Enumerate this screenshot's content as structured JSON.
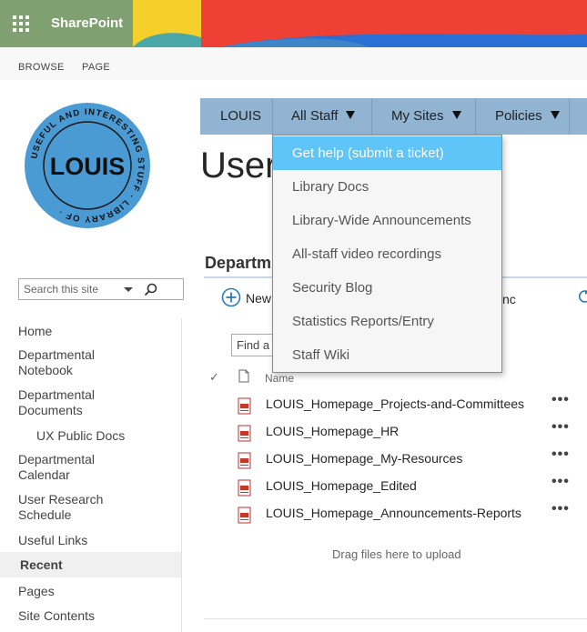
{
  "suite_bar": {
    "brand": "SharePoint",
    "colors": {
      "bar": "#7fa071",
      "banner_yellow": "#f5cf2a",
      "banner_teal": "#4aa9a8",
      "banner_red": "#ee4035",
      "banner_blue": "#2a6fd6"
    }
  },
  "ribbon": {
    "tabs": [
      "BROWSE",
      "PAGE"
    ]
  },
  "logo": {
    "text": "LOUIS",
    "ring_text": "USEFUL AND INTERESTING STUFF · LIBRARY OF ·",
    "color": "#4a9ad4"
  },
  "search": {
    "placeholder": "Search this site"
  },
  "left_nav": {
    "items": [
      {
        "label": "Home"
      },
      {
        "label": "Departmental Notebook"
      },
      {
        "label": "Departmental Documents"
      },
      {
        "label": "UX Public Docs"
      },
      {
        "label": "Departmental Calendar"
      },
      {
        "label": "User Research Schedule"
      },
      {
        "label": "Useful Links"
      },
      {
        "label": "Recent"
      },
      {
        "label": "Pages"
      },
      {
        "label": "Site Contents"
      }
    ]
  },
  "top_nav": {
    "items": [
      {
        "label": "LOUIS"
      },
      {
        "label": "All Staff"
      },
      {
        "label": "My Sites"
      },
      {
        "label": "Policies"
      }
    ],
    "color": "#91b4d3"
  },
  "page": {
    "title": "User"
  },
  "webpart": {
    "title": "Departm",
    "new_label": "New",
    "sync_fragment": "nc",
    "find_placeholder": "Find a",
    "column_name": "Name",
    "files": [
      {
        "name": "LOUIS_Homepage_Projects-and-Committees"
      },
      {
        "name": "LOUIS_Homepage_HR"
      },
      {
        "name": "LOUIS_Homepage_My-Resources"
      },
      {
        "name": "LOUIS_Homepage_Edited"
      },
      {
        "name": "LOUIS_Homepage_Announcements-Reports"
      }
    ],
    "more_label": "•••",
    "drag_hint": "Drag files here to upload"
  },
  "dropdown": {
    "items": [
      {
        "label": "Get help (submit a ticket)",
        "active": true
      },
      {
        "label": "Library Docs"
      },
      {
        "label": "Library-Wide Announcements"
      },
      {
        "label": "All-staff video recordings"
      },
      {
        "label": "Security Blog"
      },
      {
        "label": "Statistics Reports/Entry"
      },
      {
        "label": "Staff Wiki"
      }
    ],
    "highlight_color": "#5fc4f7"
  }
}
